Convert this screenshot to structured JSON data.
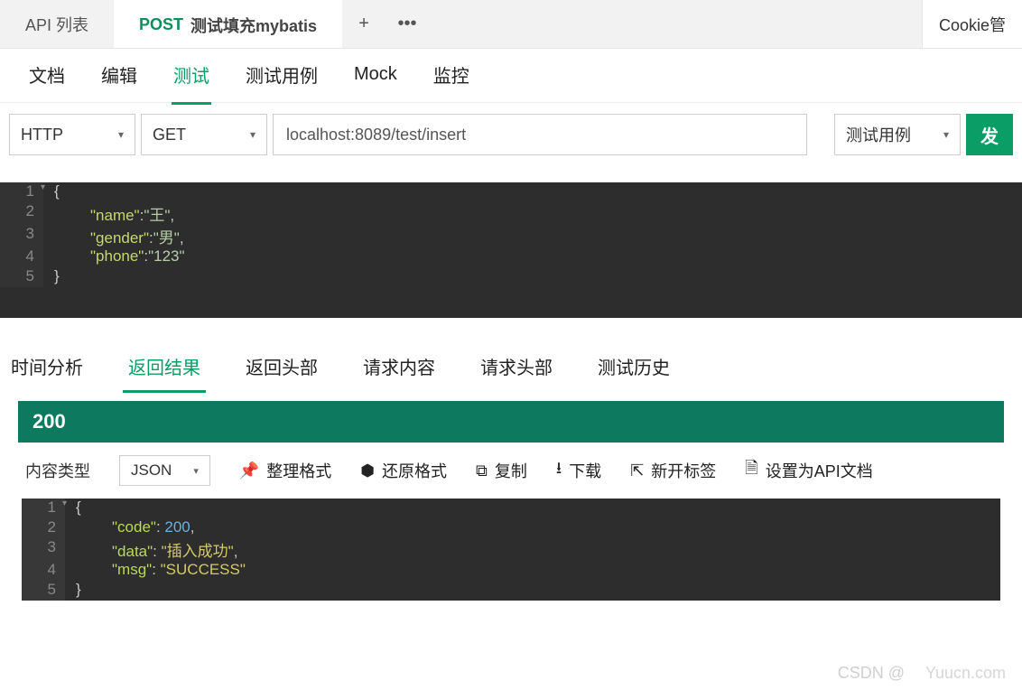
{
  "topbar": {
    "api_list": "API 列表",
    "active_tab_method": "POST",
    "active_tab_title": "测试填充mybatis",
    "cookie_btn": "Cookie管"
  },
  "subnav": {
    "items": [
      "文档",
      "编辑",
      "测试",
      "测试用例",
      "Mock",
      "监控"
    ],
    "active": 2
  },
  "request": {
    "protocol": "HTTP",
    "method": "GET",
    "url": "localhost:8089/test/insert",
    "cases_label": "测试用例",
    "send_label": "发"
  },
  "request_body": {
    "lines": [
      {
        "n": "1",
        "fold": true,
        "html": "<span class='brace'>{</span>"
      },
      {
        "n": "2",
        "indent": true,
        "html": "<span class='key'>\"name\"</span><span class='punct'>:</span><span class='str'>\"王\"</span><span class='punct'>,</span>"
      },
      {
        "n": "3",
        "indent": true,
        "html": "<span class='key'>\"gender\"</span><span class='punct'>:</span><span class='str'>\"男\"</span><span class='punct'>,</span>"
      },
      {
        "n": "4",
        "indent": true,
        "html": "<span class='key'>\"phone\"</span><span class='punct'>:</span><span class='str'>\"123\"</span>"
      },
      {
        "n": "5",
        "html": "<span class='brace'>}</span>"
      }
    ]
  },
  "result_tabs": {
    "items": [
      "时间分析",
      "返回结果",
      "返回头部",
      "请求内容",
      "请求头部",
      "测试历史"
    ],
    "active": 1
  },
  "status_code": "200",
  "response_toolbar": {
    "content_type_label": "内容类型",
    "content_type_value": "JSON",
    "format": "整理格式",
    "unformat": "还原格式",
    "copy": "复制",
    "download": "下载",
    "new_tab": "新开标签",
    "set_api_doc": "设置为API文档"
  },
  "response_body": {
    "lines": [
      {
        "n": "1",
        "fold": true,
        "html": "<span class='brace'>{</span>"
      },
      {
        "n": "2",
        "indent": true,
        "html": "<span class='resp-key'>\"code\"</span><span class='punct'>: </span><span class='resp-num'>200</span><span class='punct'>,</span>"
      },
      {
        "n": "3",
        "indent": true,
        "html": "<span class='resp-key'>\"data\"</span><span class='punct'>: </span><span class='resp-str'>\"插入成功\"</span><span class='punct'>,</span>"
      },
      {
        "n": "4",
        "indent": true,
        "html": "<span class='resp-key'>\"msg\"</span><span class='punct'>: </span><span class='resp-str'>\"SUCCESS\"</span>"
      },
      {
        "n": "5",
        "html": "<span class='brace'>}</span>"
      }
    ]
  },
  "watermark": "Yuucn.com",
  "watermark2": "CSDN @"
}
